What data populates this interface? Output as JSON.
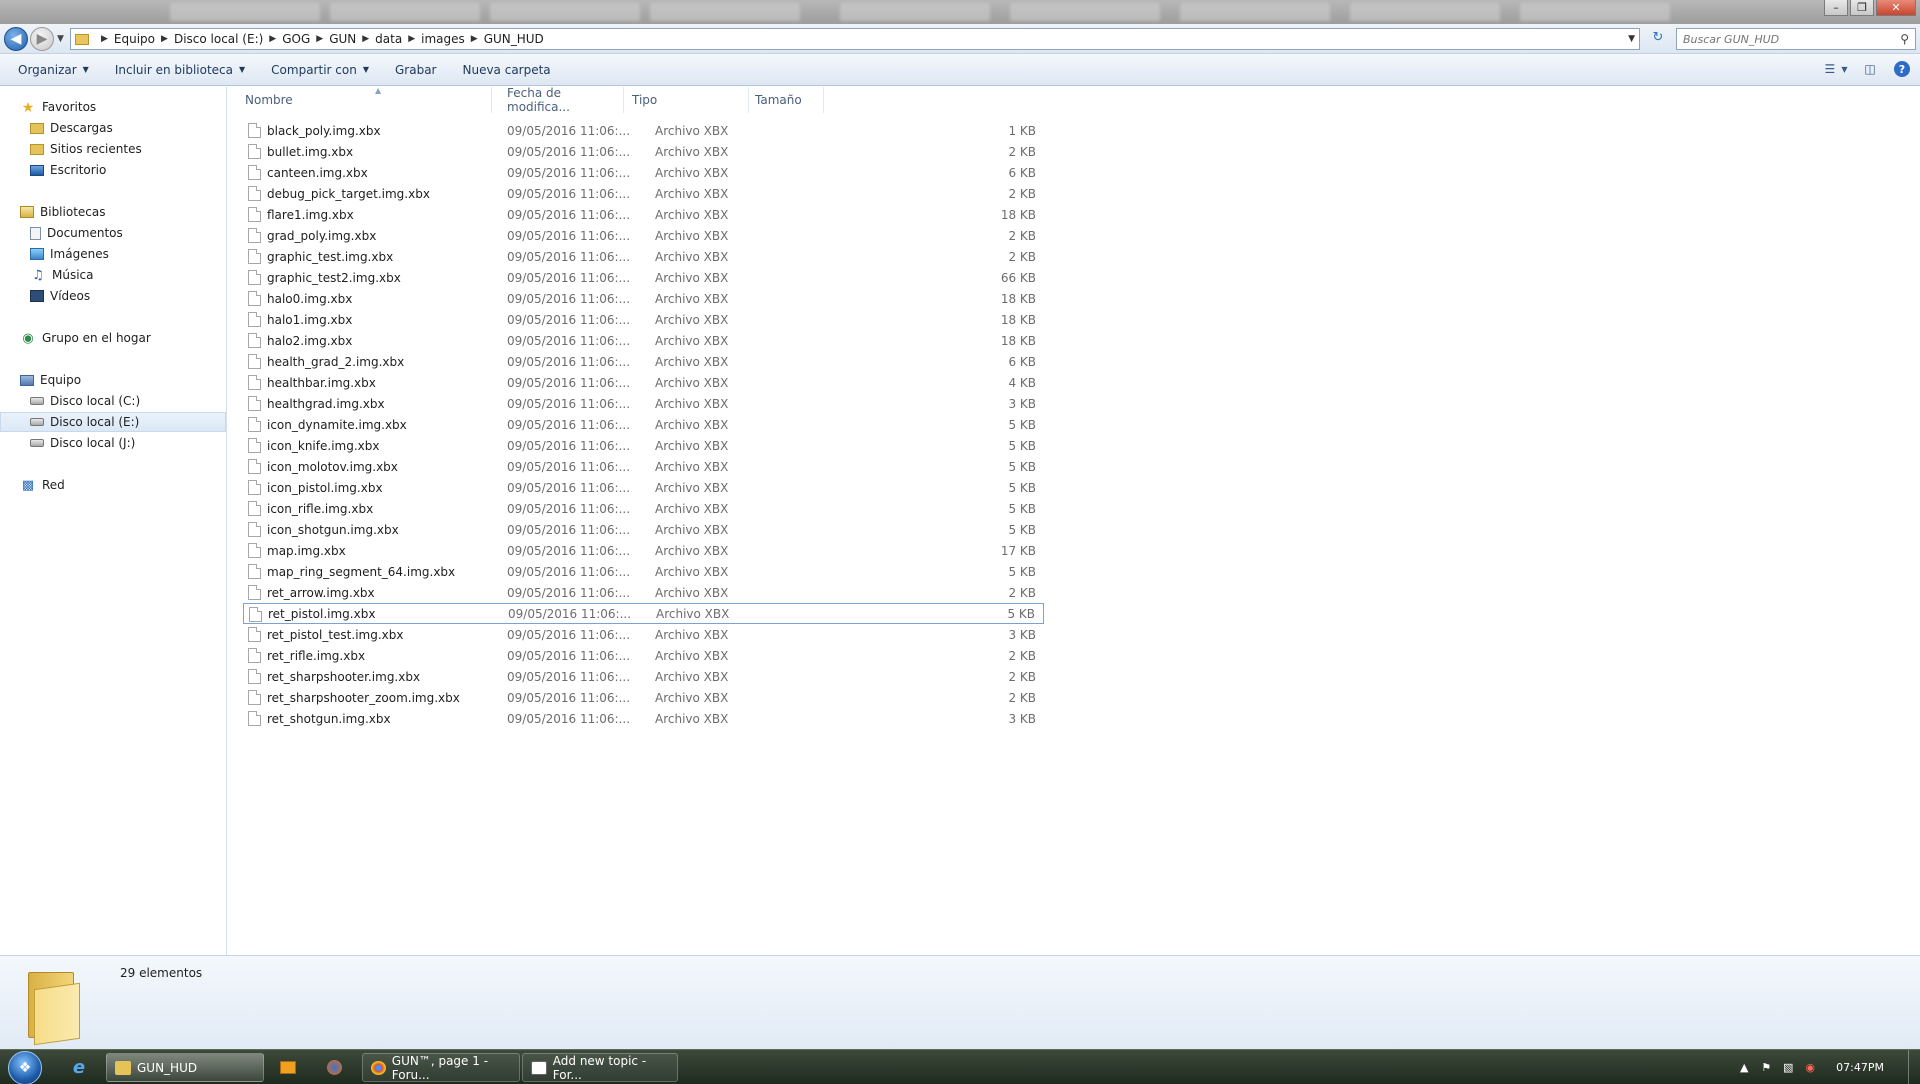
{
  "window": {
    "controls": {
      "minimize": "–",
      "maximize": "❐",
      "close": "✕"
    }
  },
  "address": {
    "breadcrumbs": [
      "Equipo",
      "Disco local (E:)",
      "GOG",
      "GUN",
      "data",
      "images",
      "GUN_HUD"
    ],
    "search_placeholder": "Buscar GUN_HUD"
  },
  "toolbar": {
    "organize": "Organizar",
    "include_library": "Incluir en biblioteca",
    "share_with": "Compartir con",
    "burn": "Grabar",
    "new_folder": "Nueva carpeta"
  },
  "nav": {
    "favorites": "Favoritos",
    "downloads": "Descargas",
    "recent": "Sitios recientes",
    "desktop": "Escritorio",
    "libraries": "Bibliotecas",
    "documents": "Documentos",
    "images": "Imágenes",
    "music": "Música",
    "videos": "Vídeos",
    "homegroup": "Grupo en el hogar",
    "computer": "Equipo",
    "drive_c": "Disco local (C:)",
    "drive_e": "Disco local (E:)",
    "drive_j": "Disco local (J:)",
    "network": "Red"
  },
  "columns": {
    "name": "Nombre",
    "modified": "Fecha de modifica...",
    "type": "Tipo",
    "size": "Tamaño"
  },
  "files": [
    {
      "name": "black_poly.img.xbx",
      "date": "09/05/2016 11:06:...",
      "type": "Archivo XBX",
      "size": "1 KB"
    },
    {
      "name": "bullet.img.xbx",
      "date": "09/05/2016 11:06:...",
      "type": "Archivo XBX",
      "size": "2 KB"
    },
    {
      "name": "canteen.img.xbx",
      "date": "09/05/2016 11:06:...",
      "type": "Archivo XBX",
      "size": "6 KB"
    },
    {
      "name": "debug_pick_target.img.xbx",
      "date": "09/05/2016 11:06:...",
      "type": "Archivo XBX",
      "size": "2 KB"
    },
    {
      "name": "flare1.img.xbx",
      "date": "09/05/2016 11:06:...",
      "type": "Archivo XBX",
      "size": "18 KB"
    },
    {
      "name": "grad_poly.img.xbx",
      "date": "09/05/2016 11:06:...",
      "type": "Archivo XBX",
      "size": "2 KB"
    },
    {
      "name": "graphic_test.img.xbx",
      "date": "09/05/2016 11:06:...",
      "type": "Archivo XBX",
      "size": "2 KB"
    },
    {
      "name": "graphic_test2.img.xbx",
      "date": "09/05/2016 11:06:...",
      "type": "Archivo XBX",
      "size": "66 KB"
    },
    {
      "name": "halo0.img.xbx",
      "date": "09/05/2016 11:06:...",
      "type": "Archivo XBX",
      "size": "18 KB"
    },
    {
      "name": "halo1.img.xbx",
      "date": "09/05/2016 11:06:...",
      "type": "Archivo XBX",
      "size": "18 KB"
    },
    {
      "name": "halo2.img.xbx",
      "date": "09/05/2016 11:06:...",
      "type": "Archivo XBX",
      "size": "18 KB"
    },
    {
      "name": "health_grad_2.img.xbx",
      "date": "09/05/2016 11:06:...",
      "type": "Archivo XBX",
      "size": "6 KB"
    },
    {
      "name": "healthbar.img.xbx",
      "date": "09/05/2016 11:06:...",
      "type": "Archivo XBX",
      "size": "4 KB"
    },
    {
      "name": "healthgrad.img.xbx",
      "date": "09/05/2016 11:06:...",
      "type": "Archivo XBX",
      "size": "3 KB"
    },
    {
      "name": "icon_dynamite.img.xbx",
      "date": "09/05/2016 11:06:...",
      "type": "Archivo XBX",
      "size": "5 KB"
    },
    {
      "name": "icon_knife.img.xbx",
      "date": "09/05/2016 11:06:...",
      "type": "Archivo XBX",
      "size": "5 KB"
    },
    {
      "name": "icon_molotov.img.xbx",
      "date": "09/05/2016 11:06:...",
      "type": "Archivo XBX",
      "size": "5 KB"
    },
    {
      "name": "icon_pistol.img.xbx",
      "date": "09/05/2016 11:06:...",
      "type": "Archivo XBX",
      "size": "5 KB"
    },
    {
      "name": "icon_rifle.img.xbx",
      "date": "09/05/2016 11:06:...",
      "type": "Archivo XBX",
      "size": "5 KB"
    },
    {
      "name": "icon_shotgun.img.xbx",
      "date": "09/05/2016 11:06:...",
      "type": "Archivo XBX",
      "size": "5 KB"
    },
    {
      "name": "map.img.xbx",
      "date": "09/05/2016 11:06:...",
      "type": "Archivo XBX",
      "size": "17 KB"
    },
    {
      "name": "map_ring_segment_64.img.xbx",
      "date": "09/05/2016 11:06:...",
      "type": "Archivo XBX",
      "size": "5 KB"
    },
    {
      "name": "ret_arrow.img.xbx",
      "date": "09/05/2016 11:06:...",
      "type": "Archivo XBX",
      "size": "2 KB"
    },
    {
      "name": "ret_pistol.img.xbx",
      "date": "09/05/2016 11:06:...",
      "type": "Archivo XBX",
      "size": "5 KB"
    },
    {
      "name": "ret_pistol_test.img.xbx",
      "date": "09/05/2016 11:06:...",
      "type": "Archivo XBX",
      "size": "3 KB"
    },
    {
      "name": "ret_rifle.img.xbx",
      "date": "09/05/2016 11:06:...",
      "type": "Archivo XBX",
      "size": "2 KB"
    },
    {
      "name": "ret_sharpshooter.img.xbx",
      "date": "09/05/2016 11:06:...",
      "type": "Archivo XBX",
      "size": "2 KB"
    },
    {
      "name": "ret_sharpshooter_zoom.img.xbx",
      "date": "09/05/2016 11:06:...",
      "type": "Archivo XBX",
      "size": "2 KB"
    },
    {
      "name": "ret_shotgun.img.xbx",
      "date": "09/05/2016 11:06:...",
      "type": "Archivo XBX",
      "size": "3 KB"
    }
  ],
  "focused_file": "ret_pistol.img.xbx",
  "status": {
    "item_count": "29 elementos"
  },
  "taskbar": {
    "explorer": "GUN_HUD",
    "chrome": "GUN™, page 1 - Foru...",
    "topic": "Add new topic - For...",
    "clock": "07:47PM"
  },
  "icons": {
    "back": "arrow-left-icon",
    "forward": "arrow-right-icon",
    "refresh": "refresh-icon",
    "search": "magnifier-icon",
    "file": "file-icon",
    "start": "windows-orb-icon"
  }
}
